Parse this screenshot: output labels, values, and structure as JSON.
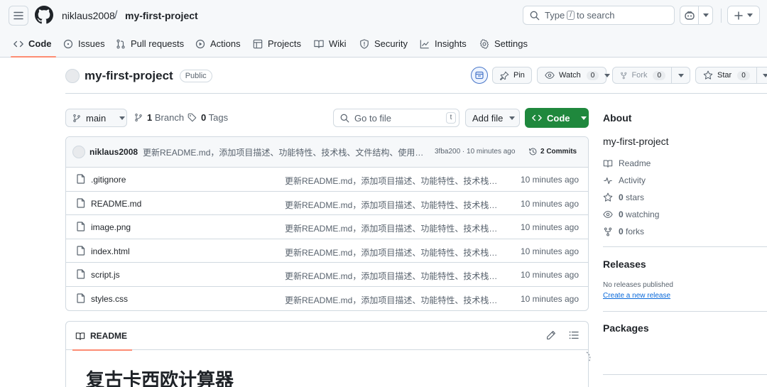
{
  "header": {
    "owner": "niklaus2008",
    "separator": "/",
    "repo": "my-first-project",
    "search": {
      "prefix": "Type",
      "key": "/",
      "suffix": "to search"
    }
  },
  "tabs": [
    {
      "label": "Code",
      "icon": "code-icon",
      "selected": true
    },
    {
      "label": "Issues",
      "icon": "issue-opened-icon"
    },
    {
      "label": "Pull requests",
      "icon": "git-pull-request-icon"
    },
    {
      "label": "Actions",
      "icon": "play-icon"
    },
    {
      "label": "Projects",
      "icon": "table-icon"
    },
    {
      "label": "Wiki",
      "icon": "book-icon"
    },
    {
      "label": "Security",
      "icon": "shield-icon"
    },
    {
      "label": "Insights",
      "icon": "graph-icon"
    },
    {
      "label": "Settings",
      "icon": "gear-icon"
    }
  ],
  "repo": {
    "name": "my-first-project",
    "visibility": "Public",
    "pin_label": "Pin",
    "watch_label": "Watch",
    "watch_count": "0",
    "fork_label": "Fork",
    "fork_count": "0",
    "star_label": "Star",
    "star_count": "0"
  },
  "filenav": {
    "branch": "main",
    "branch_count": "1",
    "branch_label": "Branch",
    "tag_count": "0",
    "tag_label": "Tags",
    "goto_placeholder": "Go to file",
    "goto_key": "t",
    "add_file_label": "Add file",
    "code_label": "Code"
  },
  "latest_commit": {
    "author": "niklaus2008",
    "message": "更新README.md，添加项目描述、功能特性、技术栈、文件结构、使用方法...",
    "meta": "3fba200 · 10 minutes ago",
    "commits_label": "2 Commits"
  },
  "files": [
    {
      "name": ".gitignore",
      "message": "更新README.md，添加项目描述、功能特性、技术栈、文...",
      "time": "10 minutes ago"
    },
    {
      "name": "README.md",
      "message": "更新README.md，添加项目描述、功能特性、技术栈、文...",
      "time": "10 minutes ago"
    },
    {
      "name": "image.png",
      "message": "更新README.md，添加项目描述、功能特性、技术栈、文...",
      "time": "10 minutes ago"
    },
    {
      "name": "index.html",
      "message": "更新README.md，添加项目描述、功能特性、技术栈、文...",
      "time": "10 minutes ago"
    },
    {
      "name": "script.js",
      "message": "更新README.md，添加项目描述、功能特性、技术栈、文...",
      "time": "10 minutes ago"
    },
    {
      "name": "styles.css",
      "message": "更新README.md，添加项目描述、功能特性、技术栈、文...",
      "time": "10 minutes ago"
    }
  ],
  "readme": {
    "tab_label": "README",
    "heading": "复古卡西欧计算器"
  },
  "sidebar": {
    "about_title": "About",
    "description": "my-first-project",
    "readme_label": "Readme",
    "activity_label": "Activity",
    "stars_count": "0",
    "stars_label": "stars",
    "watching_count": "0",
    "watching_label": "watching",
    "forks_count": "0",
    "forks_label": "forks",
    "releases_title": "Releases",
    "releases_empty": "No releases published",
    "create_release_link": "Create a new release",
    "packages_title": "Packages"
  },
  "colors": {
    "accent_green": "#1f883d",
    "tab_underline": "#fd8c73",
    "link_blue": "#0969da"
  }
}
